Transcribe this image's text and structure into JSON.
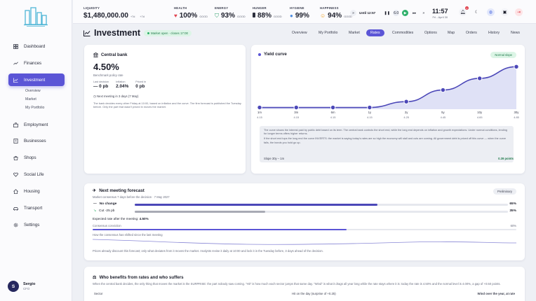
{
  "topbar": {
    "liquidity": {
      "label": "LIQUIDITY",
      "value": "$1,480,000.00",
      "sub1": "+7d",
      "sub2": "+7d"
    },
    "health": {
      "label": "HEALTH",
      "value": "100%",
      "sub": "GOOD"
    },
    "energy": {
      "label": "ENERGY",
      "value": "93%",
      "sub": "GOOD"
    },
    "hunger": {
      "label": "HUNGER",
      "value": "88%",
      "sub": "GOOD"
    },
    "hygiene": {
      "label": "HYGIENE",
      "value": "99%"
    },
    "happiness": {
      "label": "HAPPINESS",
      "value": "94%",
      "sub": "GOOD"
    },
    "until": "Until 12:57",
    "speed": "6.0",
    "time": "11:57",
    "date": "Fri - April 30",
    "notif_count": "4"
  },
  "sidebar": {
    "items": [
      {
        "label": "Dashboard",
        "icon": "dashboard-icon"
      },
      {
        "label": "Finances",
        "icon": "trend-icon"
      },
      {
        "label": "Investment",
        "icon": "chart-icon"
      },
      {
        "label": "Employment",
        "icon": "briefcase-icon"
      },
      {
        "label": "Businesses",
        "icon": "building-icon"
      },
      {
        "label": "Shops",
        "icon": "shop-icon"
      },
      {
        "label": "Social Life",
        "icon": "heart-icon"
      },
      {
        "label": "Housing",
        "icon": "house-icon"
      },
      {
        "label": "Transport",
        "icon": "car-icon"
      },
      {
        "label": "Settings",
        "icon": "gear-icon"
      }
    ],
    "subitems": [
      "Overview",
      "Market",
      "My Portfolio"
    ],
    "user": {
      "initial": "S",
      "name": "Sergio",
      "role": "CFO"
    }
  },
  "page": {
    "title": "Investment",
    "market_status": "Market open · closes 17:00",
    "tabs": [
      "Overview",
      "My Portfolio",
      "Market",
      "Rates",
      "Commodities",
      "Options",
      "Map",
      "Orders",
      "History",
      "News"
    ],
    "active_tab": "Rates"
  },
  "central_bank": {
    "title": "Central bank",
    "rate": "4.50%",
    "rate_label": "Benchmark policy rate",
    "last_decision_label": "Last decision",
    "last_decision": "— 0 pb",
    "inflation_label": "Inflation",
    "inflation": "2.04%",
    "priced_label": "Priced in",
    "priced": "0 pb",
    "next_meeting": "Next meeting in 3 days (7 May)",
    "desc": "The bank decides every other Friday at 10:00, based on inflation and the curve. The firm forecast is published the Tuesday before. Only the part that wasn't priced in moves the market."
  },
  "yield_curve": {
    "title": "Yield curve",
    "shape": "Normal slope",
    "note1": "The curve shows the interest paid by public debt based on its term. The central bank controls the short end, while the long end depends on inflation and growth expectations. Under normal conditions, lending for longer terms offers higher returns.",
    "note2": "If the short end tops the long end the curve INVERTS: the market is saying today's rates are so high the economy will stall and cuts are coming. All government debt is priced off this curve — when the curve falls, the bonds you hold go up.",
    "slope_label": "Slope 30y – 1m",
    "slope_value": "0.39 points"
  },
  "chart_data": {
    "type": "area",
    "categories": [
      "1m",
      "3m",
      "6m",
      "1y",
      "2y",
      "5y",
      "10y",
      "30y"
    ],
    "values": [
      4.15,
      4.15,
      4.15,
      4.15,
      4.25,
      4.45,
      4.65,
      4.85
    ],
    "value_labels": [
      "4.15",
      "4.15",
      "4.15",
      "4.15",
      "4.25",
      "4.45",
      "4.65",
      "4.85"
    ],
    "ylim": [
      4.0,
      5.0
    ],
    "grid": false,
    "legend": "none"
  },
  "forecast": {
    "title": "Next meeting forecast",
    "badge": "Preliminary",
    "sub": "Market consensus 7 days before the decision · 7 May 2027",
    "rows": [
      {
        "label": "No change",
        "pct": "65%",
        "value": 65,
        "color": "#4b47b8"
      },
      {
        "label": "Cut -25 pb",
        "pct": "35%",
        "value": 35,
        "color": "#a8aab4"
      }
    ],
    "expected_label": "Expected rate after the meeting",
    "expected": "4.50%",
    "conviction_label": "Consensus conviction",
    "conviction": "60%",
    "history_label": "How the consensus has shifted since the last meeting",
    "footer": "Prices already discount this forecast; only what deviates from it moves the market. Analysts revise it daily at 10:00 and lock it in the Tuesday before, 3 days ahead of the decision."
  },
  "benefits": {
    "title": "Who benefits from rates and who suffers",
    "sub": "When the central bank decides, the only thing that moves the market is the SURPRISE: the part nobody saw coming. \"Hit\" is how much each sector jumps that same day. \"Wind\" is what it drags all year long while the rate stays where it is: today the rate is 4.50% and the normal level is 4.00%, a gap of +0.50 points.",
    "col1": "Sector",
    "col2": "Hit on the day (surprise of +0.25)",
    "col3": "Wind over the year, at rate"
  }
}
